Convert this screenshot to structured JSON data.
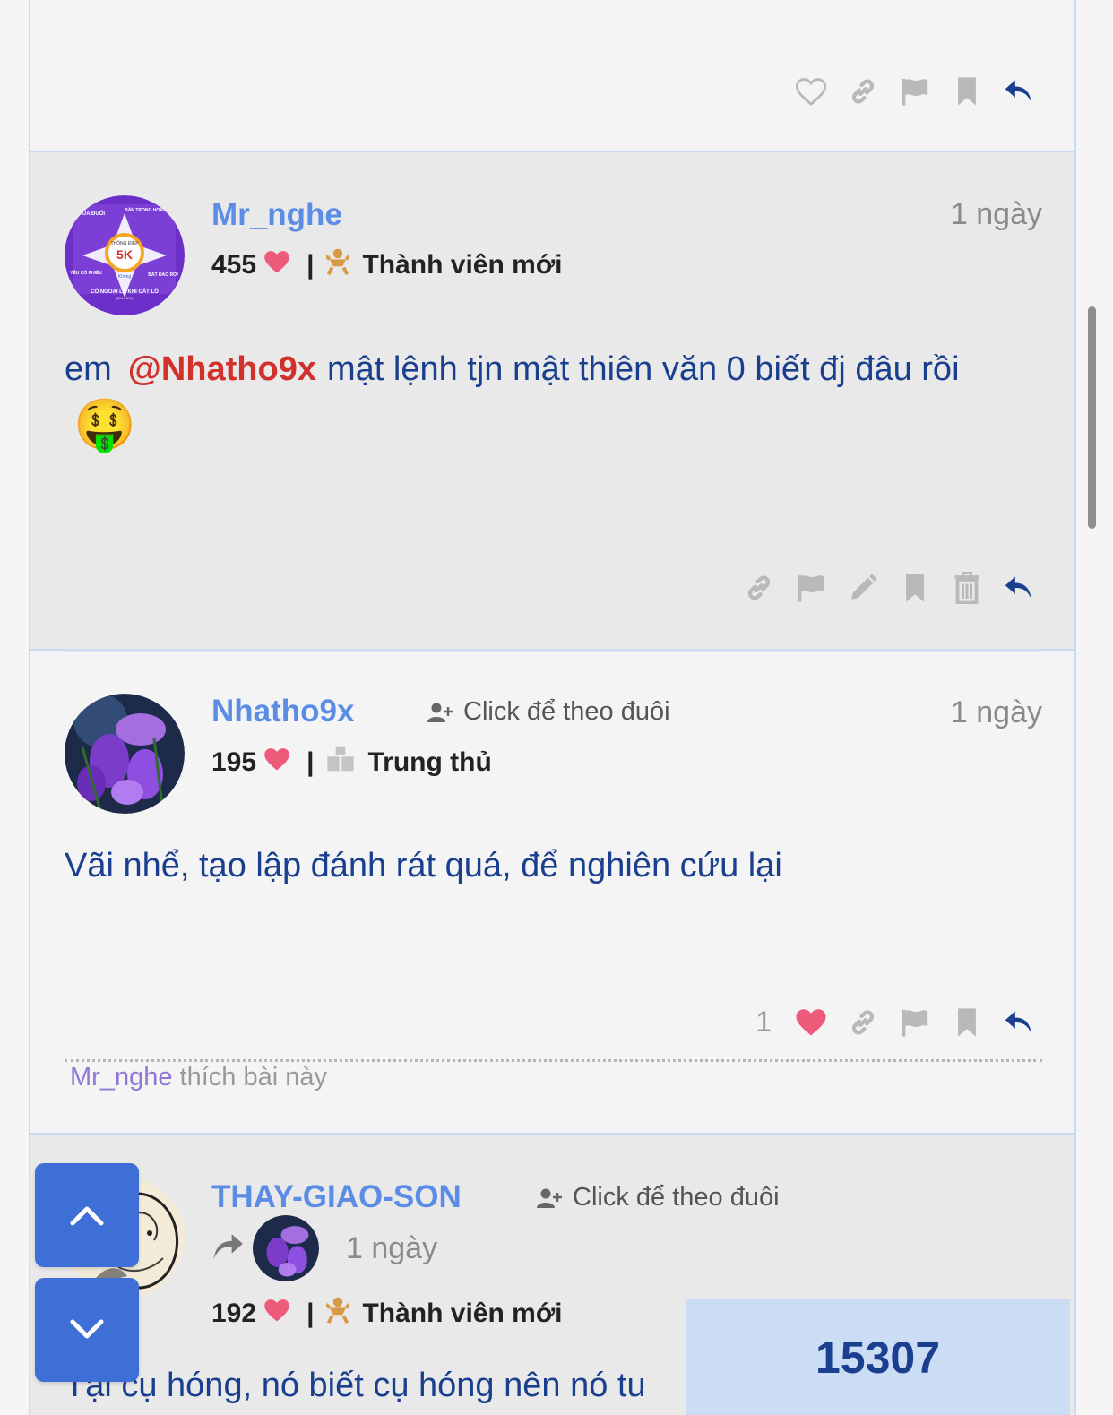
{
  "posts": [
    {
      "id": "top",
      "actions": [
        "heart-outline-icon",
        "link-icon",
        "flag-icon",
        "bookmark-icon",
        "reply-icon"
      ]
    },
    {
      "username": "Mr_nghe",
      "time": "1 ngày",
      "score": "455",
      "rank": "Thành viên mới",
      "content_start": "em",
      "mention": "@Nhatho9x",
      "content_end": "mật lệnh tjn mật thiên văn 0 biết đj đâu rồi",
      "emoji": "🤑",
      "avatar_text": {
        "top_left": "MUA ĐUỔI",
        "top_right": "BÁN TRONG HOẢNG LOẠN",
        "center_top": "THÔNG ĐIỆP",
        "center": "5K",
        "left": "YÊU CỔ PHIẾU",
        "right": "BẮT ĐÁO RƠI",
        "bottom": "CÓ NGOẠI LỆ KHI CẮT LỖ",
        "bottom_small": "(5%-10%)",
        "bubble": "Không"
      }
    },
    {
      "username": "Nhatho9x",
      "follow_text": "Click để theo đuôi",
      "time": "1 ngày",
      "score": "195",
      "rank": "Trung thủ",
      "content": "Vãi nhể, tạo lập đánh rát quá, để nghiên cứu lại",
      "like_count": "1",
      "liker": "Mr_nghe",
      "liked_text": "thích bài này"
    },
    {
      "username": "THAY-GIAO-SON",
      "follow_text": "Click để theo đuôi",
      "time": "1 ngày",
      "score": "192",
      "rank": "Thành viên mới",
      "content": "Tại cụ hóng, nó biết cụ hóng nên nó tu"
    }
  ],
  "counter": "15307",
  "colors": {
    "username": "#5b8de6",
    "content": "#1a3f8f",
    "mention": "#d2312b",
    "heart": "#ee5a7a",
    "nav_button": "#3e6fd6",
    "counter_bg": "#cbdcf5"
  }
}
